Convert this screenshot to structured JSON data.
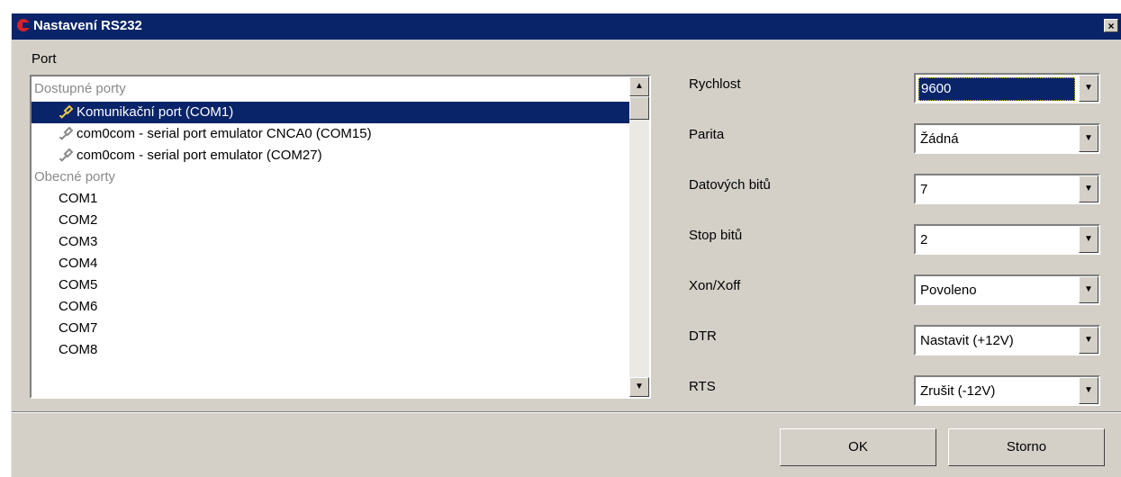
{
  "window": {
    "title": "Nastavení RS232",
    "close_symbol": "×"
  },
  "port": {
    "label": "Port",
    "groups": [
      {
        "label": "Dostupné porty",
        "items": [
          "Komunikační port (COM1)",
          "com0com - serial port emulator CNCA0 (COM15)",
          "com0com - serial port emulator (COM27)"
        ]
      },
      {
        "label": "Obecné porty",
        "items": [
          "COM1",
          "COM2",
          "COM3",
          "COM4",
          "COM5",
          "COM6",
          "COM7",
          "COM8"
        ]
      }
    ],
    "selected": "Komunikační port (COM1)"
  },
  "settings": [
    {
      "label": "Rychlost",
      "value": "9600"
    },
    {
      "label": "Parita",
      "value": "Žádná"
    },
    {
      "label": "Datových bitů",
      "value": "7"
    },
    {
      "label": "Stop bitů",
      "value": "2"
    },
    {
      "label": "Xon/Xoff",
      "value": "Povoleno"
    },
    {
      "label": "DTR",
      "value": "Nastavit (+12V)"
    },
    {
      "label": "RTS",
      "value": "Zrušit (-12V)"
    }
  ],
  "buttons": {
    "ok": "OK",
    "cancel": "Storno"
  },
  "icons": {
    "app": "app-c-icon",
    "port": "serial-plug-icon",
    "scroll_up": "▲",
    "scroll_down": "▼",
    "dropdown": "▼"
  },
  "colors": {
    "titlebar": "#0a246a",
    "selection": "#0a246a",
    "dialog_bg": "#d4d0c8"
  }
}
